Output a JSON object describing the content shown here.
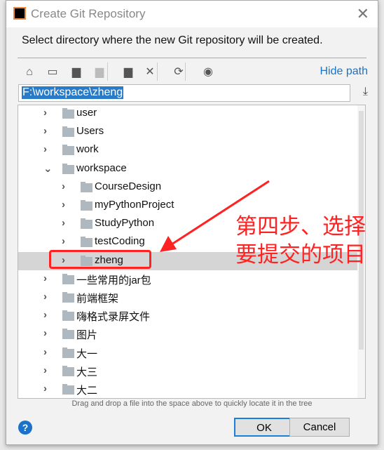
{
  "dialog": {
    "title": "Create Git Repository",
    "description": "Select directory where the new Git repository will be created.",
    "hide_path": "Hide path",
    "path_value": "F:\\workspace\\zheng",
    "hint": "Drag and drop a file into the space above to quickly locate it in the tree",
    "ok": "OK",
    "cancel": "Cancel",
    "help": "?",
    "logo": "IJ"
  },
  "toolbar": [
    "home-icon",
    "desktop-icon",
    "project-folder-icon",
    "module-folder-icon",
    "new-folder-icon",
    "delete-icon",
    "refresh-icon",
    "show-hidden-icon"
  ],
  "tree": [
    {
      "label": "user",
      "level": 1,
      "expanded": false
    },
    {
      "label": "Users",
      "level": 1,
      "expanded": false
    },
    {
      "label": "work",
      "level": 1,
      "expanded": false
    },
    {
      "label": "workspace",
      "level": 1,
      "expanded": true
    },
    {
      "label": "CourseDesign",
      "level": 2,
      "expanded": false
    },
    {
      "label": "myPythonProject",
      "level": 2,
      "expanded": false
    },
    {
      "label": "StudyPython",
      "level": 2,
      "expanded": false
    },
    {
      "label": "testCoding",
      "level": 2,
      "expanded": false
    },
    {
      "label": "zheng",
      "level": 2,
      "expanded": false,
      "selected": true
    },
    {
      "label": "一些常用的jar包",
      "level": 1,
      "expanded": false
    },
    {
      "label": "前端框架",
      "level": 1,
      "expanded": false
    },
    {
      "label": "嗨格式录屏文件",
      "level": 1,
      "expanded": false
    },
    {
      "label": "图片",
      "level": 1,
      "expanded": false
    },
    {
      "label": "大一",
      "level": 1,
      "expanded": false
    },
    {
      "label": "大三",
      "level": 1,
      "expanded": false
    },
    {
      "label": "大二",
      "level": 1,
      "expanded": false
    }
  ],
  "annotation": {
    "line1": "第四步、选择",
    "line2": "要提交的项目",
    "color": "#ff2222"
  }
}
